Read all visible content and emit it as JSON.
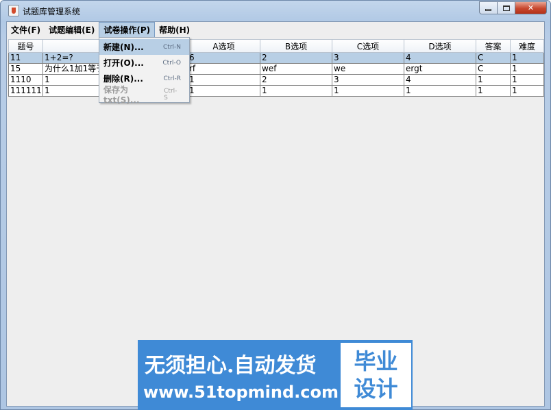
{
  "window": {
    "title": "试题库管理系统",
    "controls": {
      "minimize": "",
      "maximize": "",
      "close": "✕"
    }
  },
  "menubar": {
    "items": [
      {
        "label": "文件(F)"
      },
      {
        "label": "试题编辑(E)"
      },
      {
        "label": "试卷操作(P)"
      },
      {
        "label": "帮助(H)"
      }
    ]
  },
  "dropdown": {
    "items": [
      {
        "label": "新建(N)...",
        "accel": "Ctrl-N"
      },
      {
        "label": "打开(O)...",
        "accel": "Ctrl-O"
      },
      {
        "label": "删除(R)...",
        "accel": "Ctrl-R"
      },
      {
        "label": "保存为txt(S)...",
        "accel": "Ctrl-S"
      }
    ]
  },
  "table": {
    "columns": [
      "题号",
      "",
      "A选项",
      "B选项",
      "C选项",
      "D选项",
      "答案",
      "难度"
    ],
    "rows": [
      [
        "11",
        "1+2=?",
        "6",
        "2",
        "3",
        "4",
        "C",
        "1"
      ],
      [
        "15",
        "为什么1加1等于",
        "rf",
        "wef",
        "we",
        "ergt",
        "C",
        "1"
      ],
      [
        "1110",
        "1",
        "1",
        "2",
        "3",
        "4",
        "1",
        "1"
      ],
      [
        "111111",
        "1",
        "1",
        "1",
        "1",
        "1",
        "1",
        "1"
      ]
    ]
  },
  "watermark": {
    "main": "无须担心.自动发货",
    "url": "www.51topmind.com",
    "box_line1": "毕业",
    "box_line2": "设计"
  }
}
